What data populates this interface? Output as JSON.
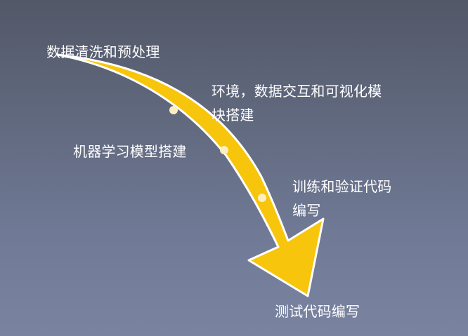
{
  "steps": [
    {
      "lines": [
        "数据清洗和预处理"
      ]
    },
    {
      "lines": [
        "环境，数据交互和可视化模",
        "块搭建"
      ]
    },
    {
      "lines": [
        "机器学习模型搭建"
      ]
    },
    {
      "lines": [
        "训练和验证代码",
        "编写"
      ]
    },
    {
      "lines": [
        "测试代码编写"
      ]
    }
  ],
  "colors": {
    "arrow_fill": "#f7c50b",
    "arrow_stroke": "#ffffff",
    "marker": "#fbeec0",
    "text": "#ffffff"
  }
}
